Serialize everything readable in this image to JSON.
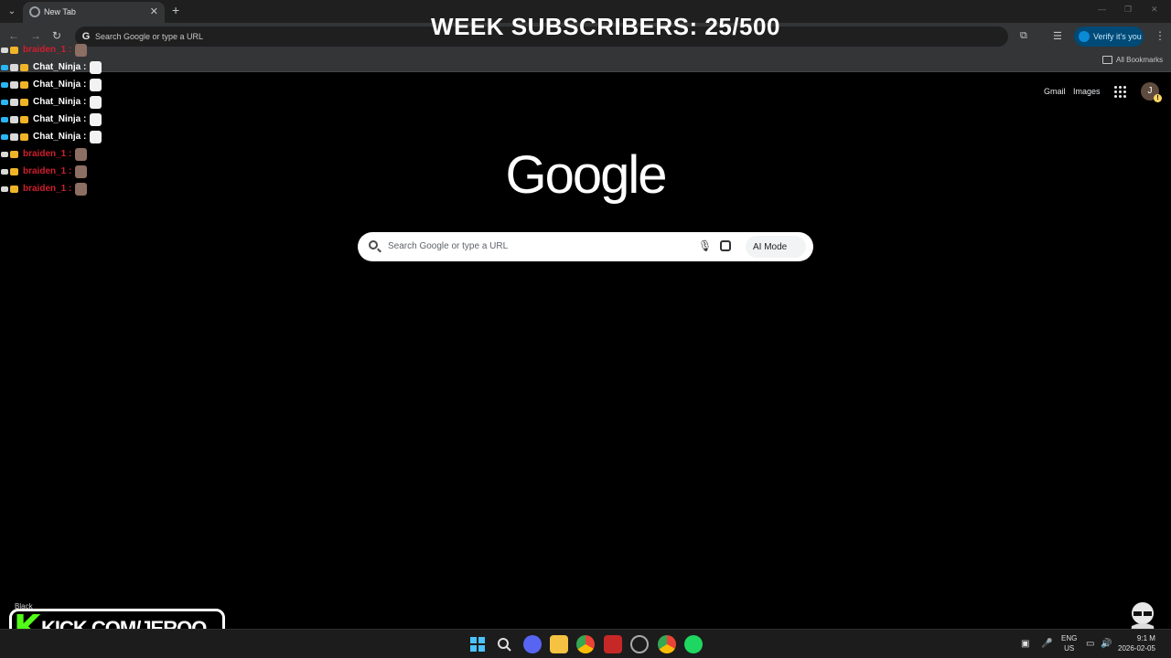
{
  "browser": {
    "tab_title": "New Tab",
    "new_tab_symbol": "+",
    "omnibox_placeholder": "Search Google or type a URL",
    "verify_label": "Verify it's you",
    "bookmarks_label": "All Bookmarks"
  },
  "overlay": {
    "subscribers_text": "WEEK SUBSCRIBERS: 25/500",
    "chat": [
      {
        "user": "braiden_1",
        "style": "braiden"
      },
      {
        "user": "Chat_Ninja",
        "style": "ninja"
      },
      {
        "user": "Chat_Ninja",
        "style": "ninja"
      },
      {
        "user": "Chat_Ninja",
        "style": "ninja"
      },
      {
        "user": "Chat_Ninja",
        "style": "ninja"
      },
      {
        "user": "Chat_Ninja",
        "style": "ninja"
      },
      {
        "user": "braiden_1",
        "style": "braiden"
      },
      {
        "user": "braiden_1",
        "style": "braiden"
      },
      {
        "user": "braiden_1",
        "style": "braiden"
      }
    ],
    "chat_separator": ":",
    "kick_letter": "K",
    "kick_url": "KICK.COM/JERQO",
    "black_label": "Black"
  },
  "ntp": {
    "gmail": "Gmail",
    "images": "Images",
    "avatar_initial": "J",
    "logo": "Google",
    "search_placeholder": "Search Google or type a URL",
    "ai_mode": "AI Mode"
  },
  "taskbar": {
    "lang_top": "ENG",
    "lang_bottom": "US",
    "time": "9:1  M",
    "date": "2026-02-05"
  },
  "colors": {
    "kick_green": "#53fc18",
    "braiden_red": "#d01e2e",
    "verify_bg": "#004a77"
  }
}
